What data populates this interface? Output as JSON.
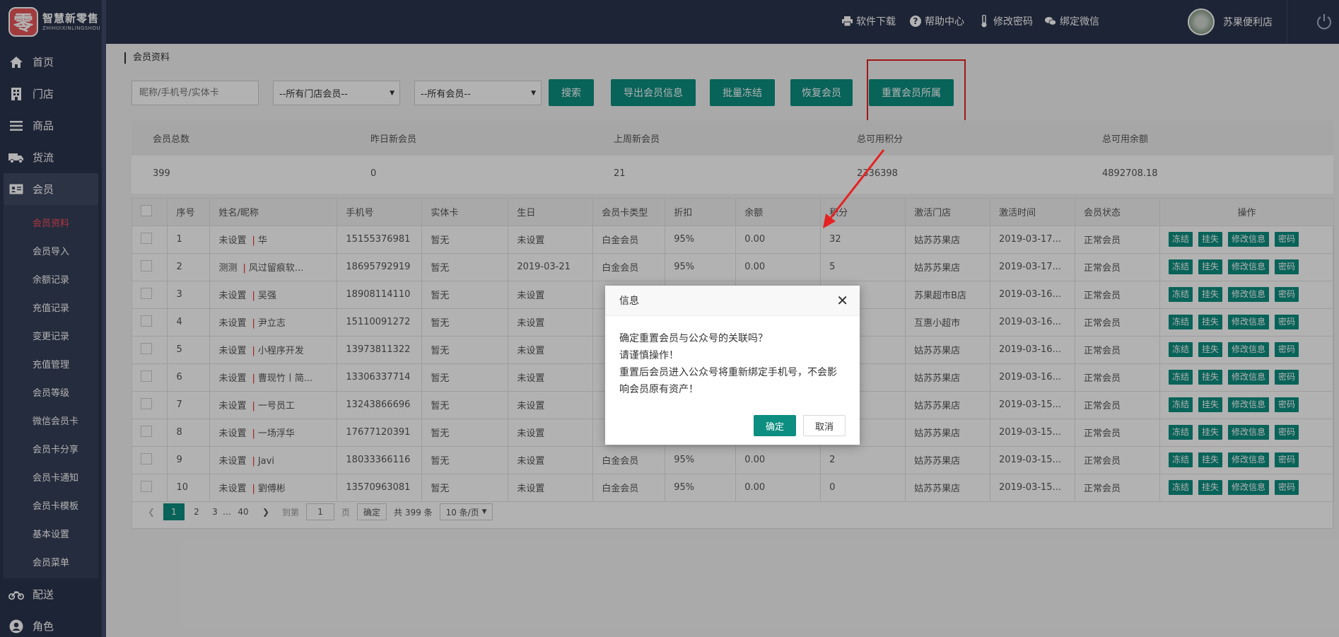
{
  "brand": {
    "mark": "零",
    "name_cn": "智慧新零售",
    "name_en": "ZHIHUIXINLINGSHOU"
  },
  "nav": {
    "items": [
      {
        "label": "首页",
        "icon": "home-icon"
      },
      {
        "label": "门店",
        "icon": "building-icon"
      },
      {
        "label": "商品",
        "icon": "list-icon"
      },
      {
        "label": "货流",
        "icon": "truck-icon"
      },
      {
        "label": "会员",
        "icon": "member-card-icon"
      }
    ],
    "sub_items": [
      "会员资料",
      "会员导入",
      "余额记录",
      "充值记录",
      "变更记录",
      "充值管理",
      "会员等级",
      "微信会员卡",
      "会员卡分享",
      "会员卡通知",
      "会员卡模板",
      "基本设置",
      "会员菜单"
    ],
    "bottom_items": [
      {
        "label": "配送",
        "icon": "motorcycle-icon"
      },
      {
        "label": "角色",
        "icon": "user-circle-icon"
      }
    ]
  },
  "topbar": {
    "links": [
      "软件下载",
      "帮助中心",
      "修改密码",
      "绑定微信"
    ],
    "store_name": "苏果便利店"
  },
  "breadcrumb": "会员资料",
  "filters": {
    "search_placeholder": "昵称/手机号/实体卡",
    "store_select": "--所有门店会员--",
    "member_select": "--所有会员--"
  },
  "buttons": {
    "search": "搜索",
    "export": "导出会员信息",
    "freeze": "批量冻结",
    "restore": "恢复会员",
    "reset": "重置会员所属"
  },
  "stats": {
    "labels": [
      "会员总数",
      "昨日新会员",
      "上周新会员",
      "总可用积分",
      "总可用余额"
    ],
    "values": [
      "399",
      "0",
      "21",
      "2336398",
      "4892708.18"
    ]
  },
  "table": {
    "headers": [
      "序号",
      "姓名/昵称",
      "手机号",
      "实体卡",
      "生日",
      "会员卡类型",
      "折扣",
      "余额",
      "积分",
      "激活门店",
      "激活时间",
      "会员状态",
      "操作"
    ],
    "rows": [
      [
        "1",
        "未设置",
        "华",
        "15155376981",
        "暂无",
        "未设置",
        "白金会员",
        "95%",
        "0.00",
        "32",
        "姑苏苏果店",
        "2019-03-17...",
        "正常会员"
      ],
      [
        "2",
        "测测",
        "风过留痕软...",
        "18695792919",
        "暂无",
        "2019-03-21",
        "白金会员",
        "95%",
        "0.00",
        "5",
        "姑苏苏果店",
        "2019-03-17...",
        "正常会员"
      ],
      [
        "3",
        "未设置",
        "吴强",
        "18908114110",
        "暂无",
        "未设置",
        "",
        "",
        "",
        "",
        "苏果超市B店",
        "2019-03-16...",
        "正常会员"
      ],
      [
        "4",
        "未设置",
        "尹立志",
        "15110091272",
        "暂无",
        "未设置",
        "",
        "",
        "",
        "",
        "互惠小超市",
        "2019-03-16...",
        "正常会员"
      ],
      [
        "5",
        "未设置",
        "小程序开发",
        "13973811322",
        "暂无",
        "未设置",
        "",
        "",
        "",
        "",
        "姑苏苏果店",
        "2019-03-16...",
        "正常会员"
      ],
      [
        "6",
        "未设置",
        "曹现竹丨简...",
        "13306337714",
        "暂无",
        "未设置",
        "",
        "",
        "",
        "",
        "姑苏苏果店",
        "2019-03-16...",
        "正常会员"
      ],
      [
        "7",
        "未设置",
        "一号员工",
        "13243866696",
        "暂无",
        "未设置",
        "",
        "",
        "",
        "",
        "姑苏苏果店",
        "2019-03-15...",
        "正常会员"
      ],
      [
        "8",
        "未设置",
        "一场浮华",
        "17677120391",
        "暂无",
        "未设置",
        "",
        "",
        "",
        "",
        "姑苏苏果店",
        "2019-03-15...",
        "正常会员"
      ],
      [
        "9",
        "未设置",
        "Javi",
        "18033366116",
        "暂无",
        "未设置",
        "白金会员",
        "95%",
        "0.00",
        "2",
        "姑苏苏果店",
        "2019-03-15...",
        "正常会员"
      ],
      [
        "10",
        "未设置",
        "劉傅彬",
        "13570963081",
        "暂无",
        "未设置",
        "白金会员",
        "95%",
        "0.00",
        "0",
        "姑苏苏果店",
        "2019-03-15...",
        "正常会员"
      ]
    ],
    "ops": [
      "冻结",
      "挂失",
      "修改信息",
      "密码"
    ]
  },
  "pager": {
    "pages": [
      "1",
      "2",
      "3",
      "…",
      "40"
    ],
    "goto_label": "到第",
    "goto_value": "1",
    "page_unit": "页",
    "confirm": "确定",
    "total": "共 399 条",
    "per_page": "10 条/页"
  },
  "dialog": {
    "title": "信息",
    "lines": [
      "确定重置会员与公众号的关联吗？",
      "请谨慎操作！",
      "重置后会员进入公众号将重新绑定手机号，不会影",
      "响会员原有资产！"
    ],
    "ok": "确定",
    "cancel": "取消"
  },
  "colors": {
    "primary": "#0c8e80",
    "sidebar": "#2a344d",
    "highlight": "#e52222",
    "active_sub": "#ff4d5c"
  }
}
